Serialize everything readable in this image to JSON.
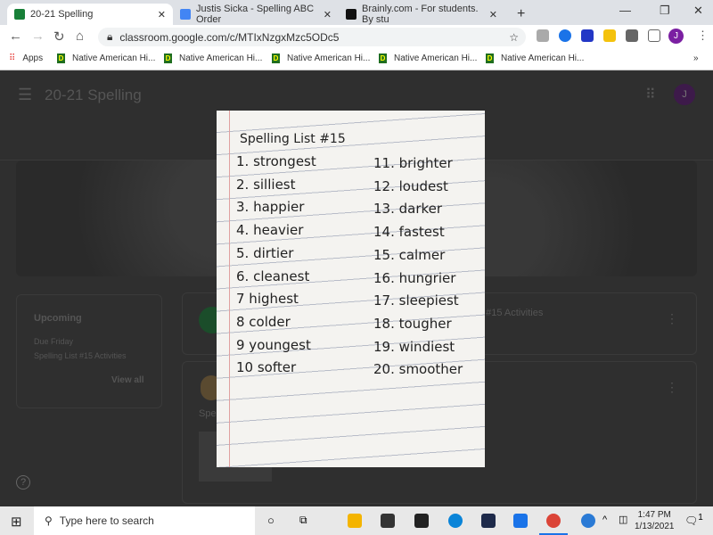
{
  "browser": {
    "tabs": [
      {
        "title": "20-21 Spelling",
        "color": "#188038"
      },
      {
        "title": "Justis Sicka - Spelling ABC Order",
        "color": "#4285f4"
      },
      {
        "title": "Brainly.com - For students. By stu",
        "color": "#111111"
      }
    ],
    "url": "classroom.google.com/c/MTIxNzgxMzc5ODc5",
    "profile_initial": "J",
    "bookmarks": [
      "Apps",
      "Native American Hi...",
      "Native American Hi...",
      "Native American Hi...",
      "Native American Hi...",
      "Native American Hi..."
    ],
    "overflow": "»"
  },
  "classroom": {
    "title": "20-21 Spelling",
    "avatar": "J",
    "upcoming": {
      "heading": "Upcoming",
      "due": "Due Friday",
      "item": "Spelling List #15 Activities",
      "view_all": "View all"
    },
    "post_title_partial": "t #15 Activities",
    "post2_partial": "Spel",
    "help": "?"
  },
  "photo": {
    "title": "Spelling List #15",
    "words": [
      "1. strongest",
      "2. silliest",
      "3. happier",
      "4. heavier",
      "5. dirtier",
      "6. cleanest",
      "7 highest",
      "8 colder",
      "9 youngest",
      "10 softer",
      "11. brighter",
      "12. loudest",
      "13. darker",
      "14. fastest",
      "15. calmer",
      "16. hungrier",
      "17. sleepiest",
      "18. tougher",
      "19. windiest",
      "20. smoother"
    ]
  },
  "taskbar": {
    "search_placeholder": "Type here to search",
    "time": "1:47 PM",
    "date": "1/13/2021",
    "notifications": "1"
  }
}
